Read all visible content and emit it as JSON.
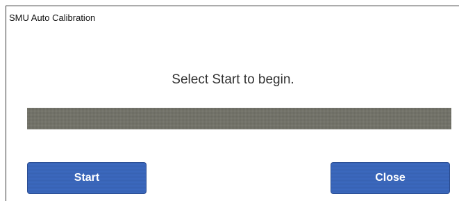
{
  "window": {
    "title": "SMU Auto Calibration"
  },
  "main": {
    "message": "Select Start to begin.",
    "progress": {
      "value_percent": 0,
      "track_color": "#727268",
      "fill_color": "#3a62b6"
    }
  },
  "buttons": {
    "start_label": "Start",
    "close_label": "Close",
    "color": "#3b68be"
  }
}
